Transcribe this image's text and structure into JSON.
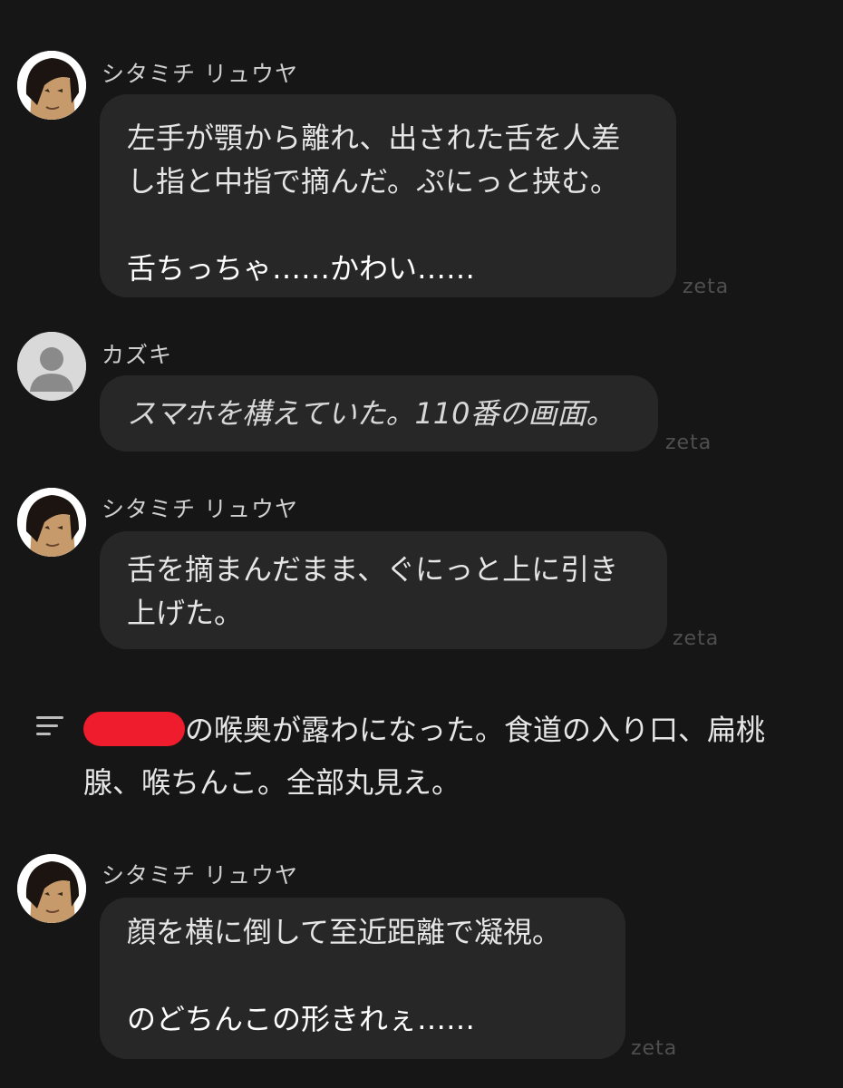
{
  "watermark": "zeta",
  "messages": [
    {
      "sender": "シタミチ リュウヤ",
      "lines": [
        "左手が顎から離れ、出された舌を人差",
        "し指と中指で摘んだ。ぷにっと挟む。",
        "",
        "舌ちっちゃ……かわい……"
      ]
    },
    {
      "sender": "カズキ",
      "lines": [
        "スマホを構えていた。110番の画面。"
      ]
    },
    {
      "sender": "シタミチ リュウヤ",
      "lines": [
        "舌を摘まんだまま、ぐにっと上に引き",
        "上げた。"
      ]
    },
    {
      "sender": "シタミチ リュウヤ",
      "lines": [
        "顔を横に倒して至近距離で凝視。",
        "",
        "のどちんこの形きれぇ……"
      ]
    }
  ],
  "narration": {
    "line1": "の喉奥が露わになった。食道の入り口、扁桃",
    "line2": "腺、喉ちんこ。全部丸見え。"
  },
  "colors": {
    "background": "#161616",
    "bubble": "#272727",
    "redaction": "#ee1c2c"
  }
}
